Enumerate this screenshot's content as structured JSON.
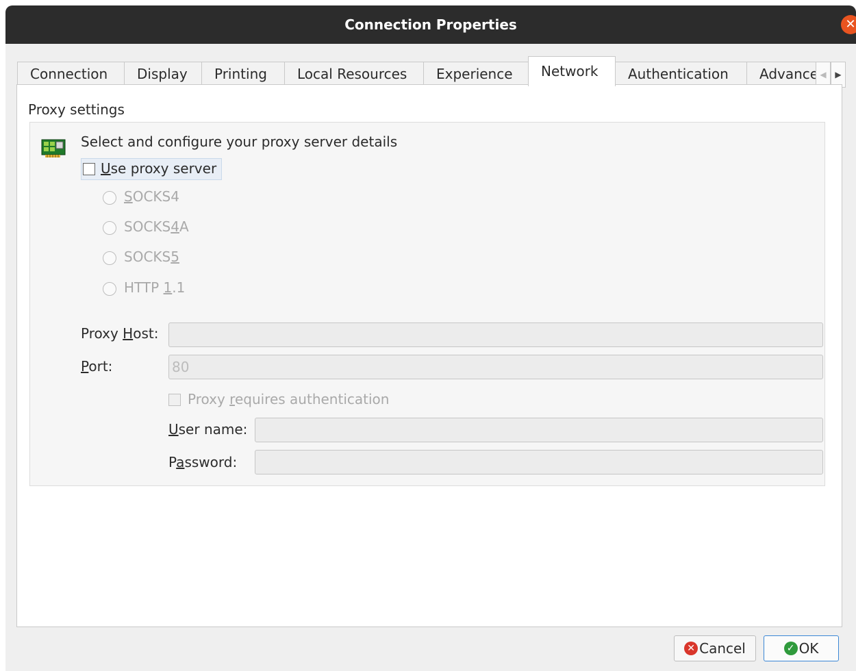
{
  "window": {
    "title": "Connection Properties"
  },
  "tabs": [
    "Connection",
    "Display",
    "Printing",
    "Local Resources",
    "Experience",
    "Network",
    "Authentication",
    "Advance"
  ],
  "section_title": "Proxy settings",
  "group": {
    "header": "Select and configure your proxy server details",
    "use_proxy_label": "Use proxy server",
    "use_proxy_checked": false,
    "proxy_types": [
      "SOCKS4",
      "SOCKS4A",
      "SOCKS5",
      "HTTP 1.1"
    ]
  },
  "fields": {
    "host_label": "Proxy Host:",
    "host_value": "",
    "port_label": "Port:",
    "port_value": "80",
    "auth_label": "Proxy requires authentication",
    "username_label": "User name:",
    "username_value": "",
    "password_label": "Password:",
    "password_value": ""
  },
  "buttons": {
    "cancel": "Cancel",
    "ok": "OK"
  },
  "colors": {
    "title_bg": "#2c2c2c",
    "close": "#e95420",
    "cancel_icon": "#d9362b",
    "ok_icon": "#2f9a3c",
    "focus_border": "#3b87d6"
  },
  "icons": {
    "close": "close-icon",
    "network": "network-card-icon",
    "cancel": "cancel-icon",
    "ok": "check-icon"
  }
}
